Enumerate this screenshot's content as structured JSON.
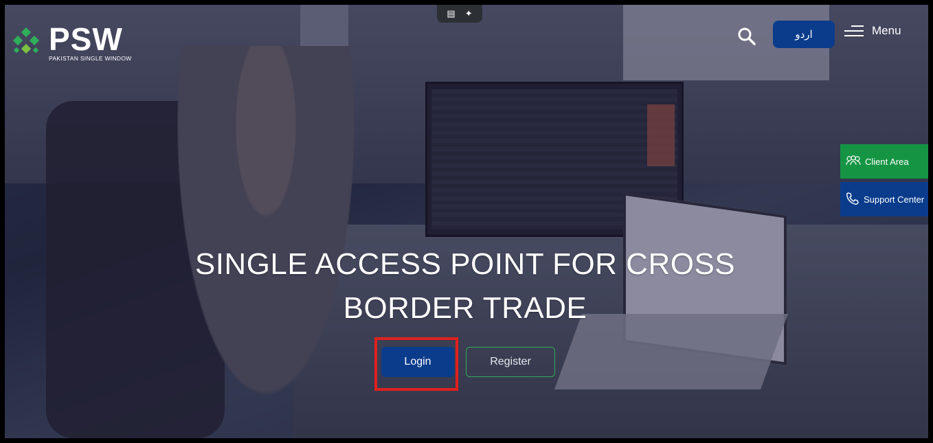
{
  "header": {
    "logo_word": "PSW",
    "logo_subtitle": "PAKISTAN SINGLE WINDOW",
    "language_button": "اردو",
    "menu_label": "Menu"
  },
  "side_buttons": {
    "client_area": "Client Area",
    "support_center": "Support Center"
  },
  "hero": {
    "headline": "SINGLE ACCESS POINT FOR CROSS BORDER TRADE",
    "login_label": "Login",
    "register_label": "Register"
  },
  "icons": [
    "psw-logo-icon",
    "search-icon",
    "hamburger-menu-icon",
    "users-icon",
    "phone-icon",
    "camera-icon",
    "sparkle-icon"
  ],
  "colors": {
    "brand_blue": "#0b3c8c",
    "brand_green": "#159544",
    "highlight_red": "#e0201e"
  }
}
